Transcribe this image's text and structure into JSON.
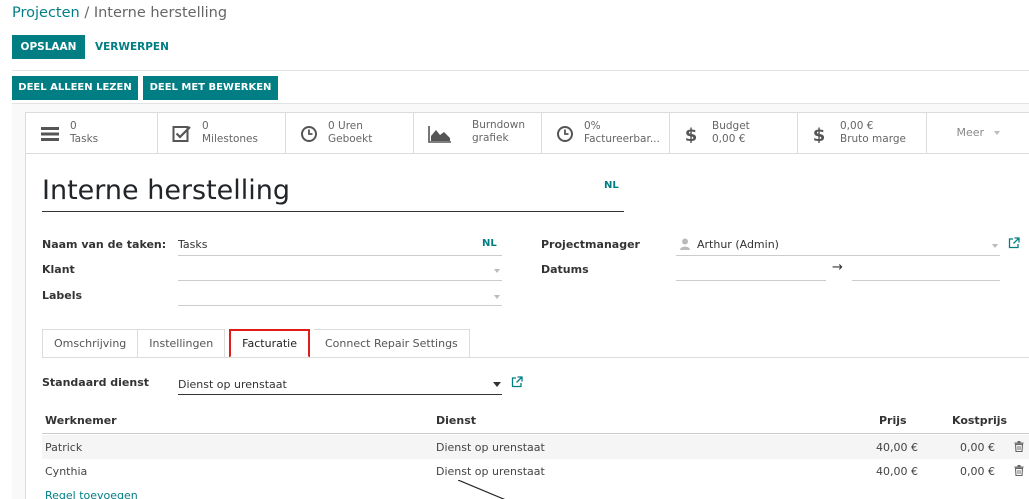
{
  "breadcrumb": {
    "parent": "Projecten",
    "separator": " / ",
    "current": "Interne herstelling"
  },
  "toolbar": {
    "save_label": "OPSLAAN",
    "discard_label": "VERWERPEN"
  },
  "share": {
    "read_only_label": "DEEL ALLEEN LEZEN",
    "edit_label": "DEEL MET BEWERKEN"
  },
  "stats": [
    {
      "value": "0",
      "label": "Tasks",
      "icon": "tasks-icon"
    },
    {
      "value": "0",
      "label": "Milestones",
      "icon": "check-square-icon"
    },
    {
      "value": "0 Uren",
      "label": "Geboekt",
      "icon": "clock-icon"
    },
    {
      "value": "Burndown",
      "label": "grafiek",
      "icon": "area-chart-icon"
    },
    {
      "value": "0%",
      "label": "Factureerbar...",
      "icon": "clock-icon"
    },
    {
      "value": "Budget",
      "label": "0,00 €",
      "icon": "dollar-icon"
    },
    {
      "value": "0,00 €",
      "label": "Bruto marge",
      "icon": "dollar-icon"
    }
  ],
  "more_label": "Meer",
  "form": {
    "title": "Interne herstelling",
    "lang_badge": "NL",
    "task_name_label": "Naam van de taken:",
    "task_name_value": "Tasks",
    "customer_label": "Klant",
    "labels_label": "Labels",
    "manager_label": "Projectmanager",
    "manager_value": "Arthur (Admin)",
    "dates_label": "Datums",
    "date_arrow": "→"
  },
  "tabs": [
    {
      "label": "Omschrijving",
      "active": false
    },
    {
      "label": "Instellingen",
      "active": false
    },
    {
      "label": "Facturatie",
      "active": true
    },
    {
      "label": "Connect Repair Settings",
      "active": false
    }
  ],
  "billing": {
    "default_service_label": "Standaard dienst",
    "default_service_value": "Dienst op urenstaat",
    "columns": [
      "Werknemer",
      "Dienst",
      "Prijs",
      "Kostprijs"
    ],
    "rows": [
      {
        "employee": "Patrick",
        "service": "Dienst op urenstaat",
        "price": "40,00 €",
        "cost": "0,00 €"
      },
      {
        "employee": "Cynthia",
        "service": "Dienst op urenstaat",
        "price": "40,00 €",
        "cost": "0,00 €"
      }
    ],
    "add_line_label": "Regel toevoegen"
  },
  "colors": {
    "primary": "#017e84",
    "highlight": "#e21b1b"
  }
}
